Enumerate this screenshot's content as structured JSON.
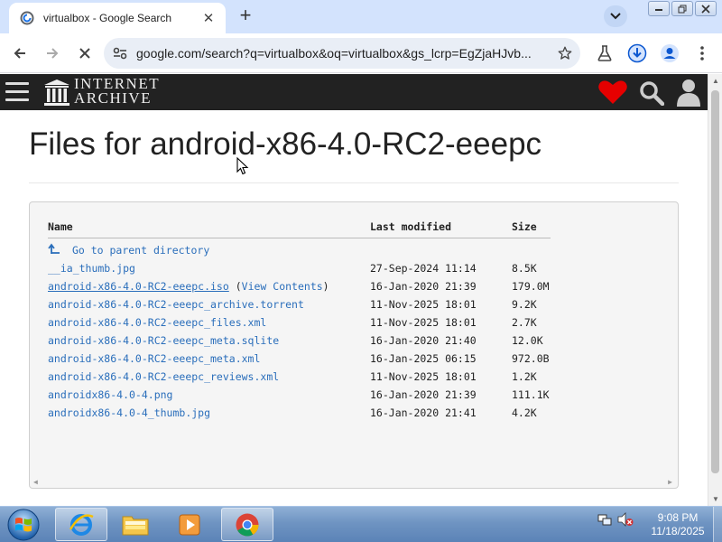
{
  "browser": {
    "tab": {
      "title": "virtualbox - Google Search",
      "close_glyph": "✕"
    },
    "new_tab_glyph": "+",
    "address": "google.com/search?q=virtualbox&oq=virtualbox&gs_lcrp=EgZjaHJvb...",
    "colors": {
      "tabstrip": "#d3e3fd",
      "omnibox": "#e9eef6",
      "accent": "#0b57d0"
    }
  },
  "archive": {
    "logo_line1": "INTERNET",
    "logo_line2": "ARCHIVE",
    "colors": {
      "header": "#222222",
      "heart": "#e60000",
      "link": "#2a6ebb"
    }
  },
  "page": {
    "title": "Files for android-x86-4.0-RC2-eeepc"
  },
  "file_table": {
    "headers": {
      "name": "Name",
      "modified": "Last modified",
      "size": "Size"
    },
    "parent_link": "Go to parent directory",
    "rows": [
      {
        "name": "__ia_thumb.jpg",
        "modified": "27-Sep-2024 11:14",
        "size": "8.5K",
        "link": false
      },
      {
        "name": "android-x86-4.0-RC2-eeepc.iso",
        "extra": "View Contents",
        "modified": "16-Jan-2020 21:39",
        "size": "179.0M",
        "link": true
      },
      {
        "name": "android-x86-4.0-RC2-eeepc_archive.torrent",
        "modified": "11-Nov-2025 18:01",
        "size": "9.2K",
        "link": false
      },
      {
        "name": "android-x86-4.0-RC2-eeepc_files.xml",
        "modified": "11-Nov-2025 18:01",
        "size": "2.7K",
        "link": false
      },
      {
        "name": "android-x86-4.0-RC2-eeepc_meta.sqlite",
        "modified": "16-Jan-2020 21:40",
        "size": "12.0K",
        "link": false
      },
      {
        "name": "android-x86-4.0-RC2-eeepc_meta.xml",
        "modified": "16-Jan-2025 06:15",
        "size": "972.0B",
        "link": false
      },
      {
        "name": "android-x86-4.0-RC2-eeepc_reviews.xml",
        "modified": "11-Nov-2025 18:01",
        "size": "1.2K",
        "link": false
      },
      {
        "name": "androidx86-4.0-4.png",
        "modified": "16-Jan-2020 21:39",
        "size": "111.1K",
        "link": false
      },
      {
        "name": "androidx86-4.0-4_thumb.jpg",
        "modified": "16-Jan-2020 21:41",
        "size": "4.2K",
        "link": false
      }
    ]
  },
  "taskbar": {
    "time": "9:08 PM",
    "date": "11/18/2025",
    "apps": [
      "internet-explorer-icon",
      "windows-explorer-icon",
      "media-player-icon",
      "chrome-icon"
    ]
  }
}
